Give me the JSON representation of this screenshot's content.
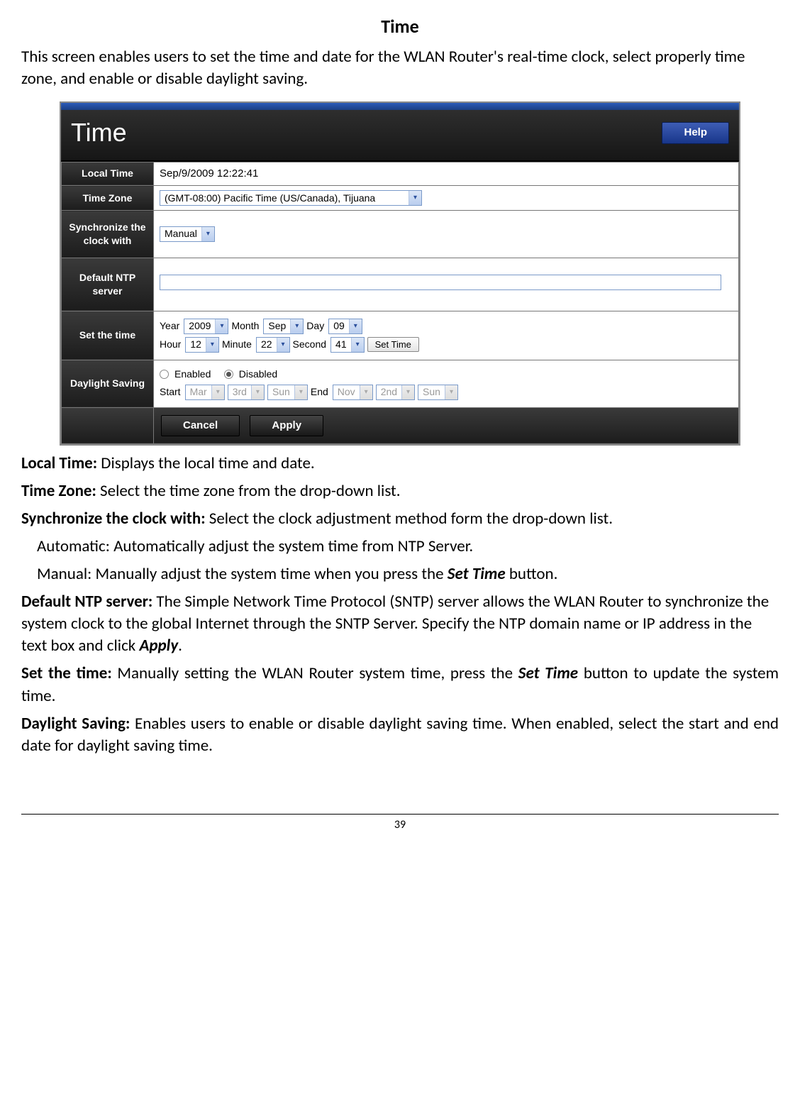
{
  "page": {
    "title": "Time",
    "intro": "This screen enables users to set the time and date for the WLAN Router's real-time clock, select properly time zone, and enable or disable daylight saving.",
    "page_number": "39"
  },
  "shot": {
    "header_title": "Time",
    "help_label": "Help",
    "labels": {
      "local_time": "Local Time",
      "time_zone": "Time Zone",
      "sync": "Synchronize the clock with",
      "ntp": "Default NTP server",
      "set_time": "Set the time",
      "daylight": "Daylight Saving"
    },
    "local_time_value": "Sep/9/2009 12:22:41",
    "time_zone_selected": "(GMT-08:00) Pacific Time (US/Canada), Tijuana",
    "sync_selected": "Manual",
    "ntp_value": "",
    "set_time_inline": {
      "year_lbl": "Year",
      "year_val": "2009",
      "month_lbl": "Month",
      "month_val": "Sep",
      "day_lbl": "Day",
      "day_val": "09",
      "hour_lbl": "Hour",
      "hour_val": "12",
      "minute_lbl": "Minute",
      "minute_val": "22",
      "second_lbl": "Second",
      "second_val": "41",
      "set_time_btn": "Set Time"
    },
    "daylight": {
      "enabled_lbl": "Enabled",
      "disabled_lbl": "Disabled",
      "selected": "Disabled",
      "start_lbl": "Start",
      "end_lbl": "End",
      "start_month": "Mar",
      "start_week": "3rd",
      "start_day": "Sun",
      "end_month": "Nov",
      "end_week": "2nd",
      "end_day": "Sun"
    },
    "footer": {
      "cancel": "Cancel",
      "apply": "Apply"
    }
  },
  "desc": {
    "local_time_head": "Local Time:",
    "local_time_text": " Displays the local time and date.",
    "time_zone_head": "Time Zone:",
    "time_zone_text": " Select the time zone from the drop-down list.",
    "sync_head": "Synchronize the clock with:",
    "sync_text": " Select the clock adjustment method form the drop-down list.",
    "sync_auto": "Automatic: Automatically adjust the system time from NTP Server.",
    "sync_manual_pre": "Manual: Manually adjust the system time when you press the ",
    "sync_manual_bold": "Set Time",
    "sync_manual_post": " button.",
    "ntp_head": "Default NTP server:",
    "ntp_text_pre": " The Simple Network Time Protocol (SNTP) server allows the WLAN Router to synchronize the system clock to the global Internet through the SNTP Server. Specify the NTP domain name or IP address in the text box and click ",
    "ntp_text_bold": "Apply",
    "ntp_text_post": ".",
    "settime_head": "Set the time:",
    "settime_text_pre": " Manually setting the WLAN Router system time, press the ",
    "settime_text_bold": "Set Time",
    "settime_text_post": " button to update the system time.",
    "daylight_head": "Daylight Saving:",
    "daylight_text": " Enables users to enable or disable daylight saving time. When enabled, select the start and end date for daylight saving time."
  }
}
